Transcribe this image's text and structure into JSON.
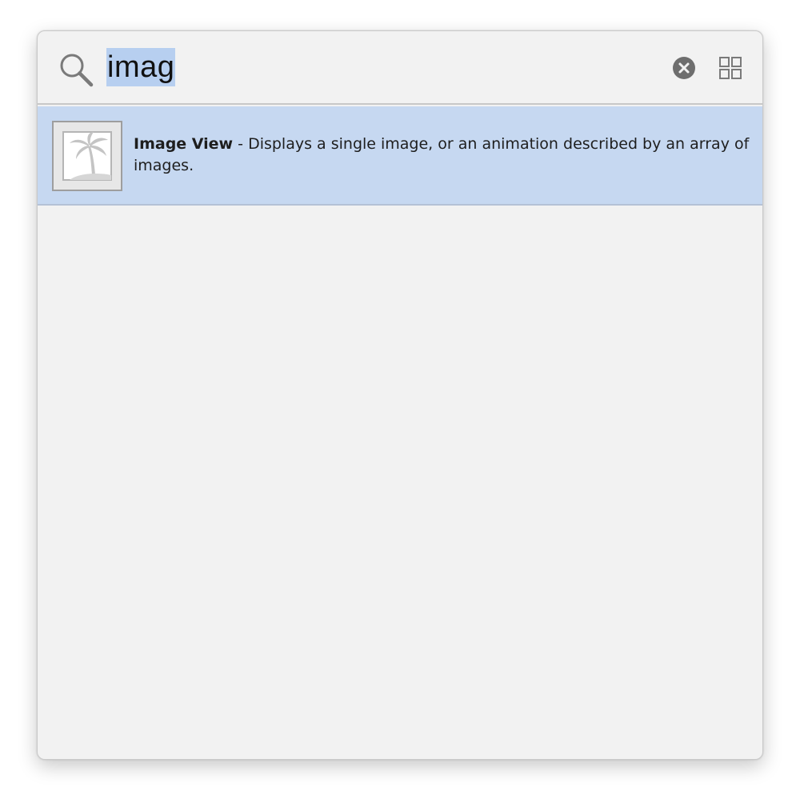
{
  "search": {
    "query": "imag"
  },
  "results": [
    {
      "title": "Image View",
      "separator": " - ",
      "description": "Displays a single image, or an animation described by an array of images."
    }
  ],
  "icons": {
    "search": "magnifier-icon",
    "clear": "clear-circle-x-icon",
    "grid": "grid-view-icon",
    "thumbnail": "palm-tree-image-icon"
  },
  "colors": {
    "panel_background": "#f2f2f2",
    "selection": "#c6d8f1",
    "text_highlight": "#b7cff0"
  }
}
